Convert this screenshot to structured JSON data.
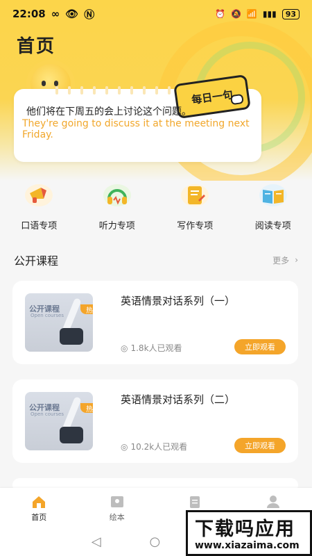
{
  "status_bar": {
    "time": "22:08",
    "battery": "93"
  },
  "page": {
    "title": "首页"
  },
  "daily_sentence": {
    "tag": "每日一句",
    "chinese": "他们将在下周五的会上讨论这个问题。",
    "english": "They're going to discuss it at the meeting next Friday."
  },
  "categories": [
    {
      "label": "口语专项",
      "icon": "megaphone-icon"
    },
    {
      "label": "听力专项",
      "icon": "headphones-icon"
    },
    {
      "label": "写作专项",
      "icon": "document-pencil-icon"
    },
    {
      "label": "阅读专项",
      "icon": "open-book-icon"
    }
  ],
  "section": {
    "title": "公开课程",
    "more": "更多"
  },
  "courses": [
    {
      "title": "英语情景对话系列（一）",
      "views": "1.8k人已观看",
      "badge": "热门",
      "button": "立即观看",
      "thumb_title": "公开课程",
      "thumb_sub": "Open courses"
    },
    {
      "title": "英语情景对话系列（二）",
      "views": "10.2k人已观看",
      "badge": "热门",
      "button": "立即观看",
      "thumb_title": "公开课程",
      "thumb_sub": "Open courses"
    }
  ],
  "tabs": [
    {
      "label": "首页",
      "icon": "home-icon"
    },
    {
      "label": "绘本",
      "icon": "picture-book-icon"
    },
    {
      "label": "",
      "icon": "clipboard-icon"
    },
    {
      "label": "",
      "icon": "user-icon"
    }
  ],
  "watermark": {
    "line1": "下载吗应用",
    "line2": "www.xiazaima.com"
  },
  "colors": {
    "accent": "#f4a52a",
    "hero": "#fcd54a"
  }
}
